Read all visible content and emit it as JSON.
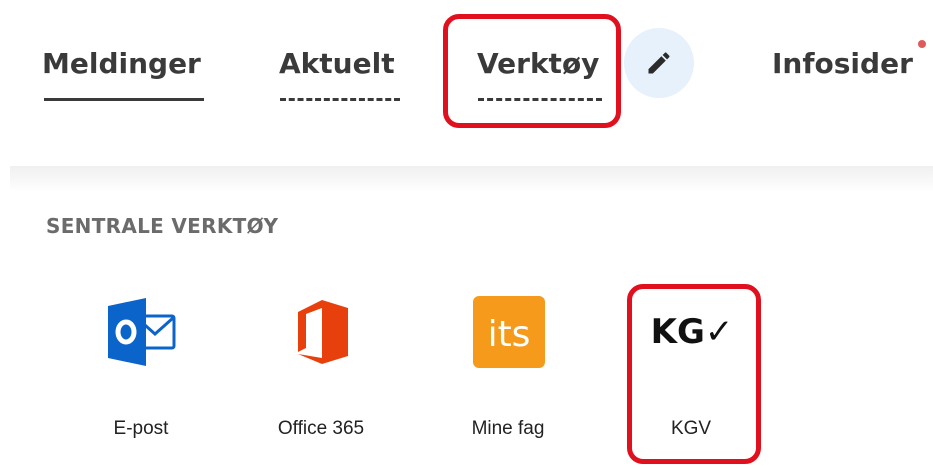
{
  "nav": {
    "tabs": [
      {
        "label": "Meldinger"
      },
      {
        "label": "Aktuelt"
      },
      {
        "label": "Verktøy"
      },
      {
        "label": "Infosider"
      }
    ],
    "edit_icon": "pencil-icon"
  },
  "section": {
    "title": "SENTRALE VERKTØY"
  },
  "tools": [
    {
      "label": "E-post",
      "icon": "outlook-icon",
      "color": "#0a64c9"
    },
    {
      "label": "Office 365",
      "icon": "office-icon",
      "color": "#e8400c"
    },
    {
      "label": "Mine fag",
      "icon": "its-icon",
      "color": "#f59a1b",
      "icon_text": "its"
    },
    {
      "label": "KGV",
      "icon": "kgv-icon",
      "color": "#111111",
      "icon_text": "KG✓"
    }
  ],
  "highlight_color": "#e0101e"
}
